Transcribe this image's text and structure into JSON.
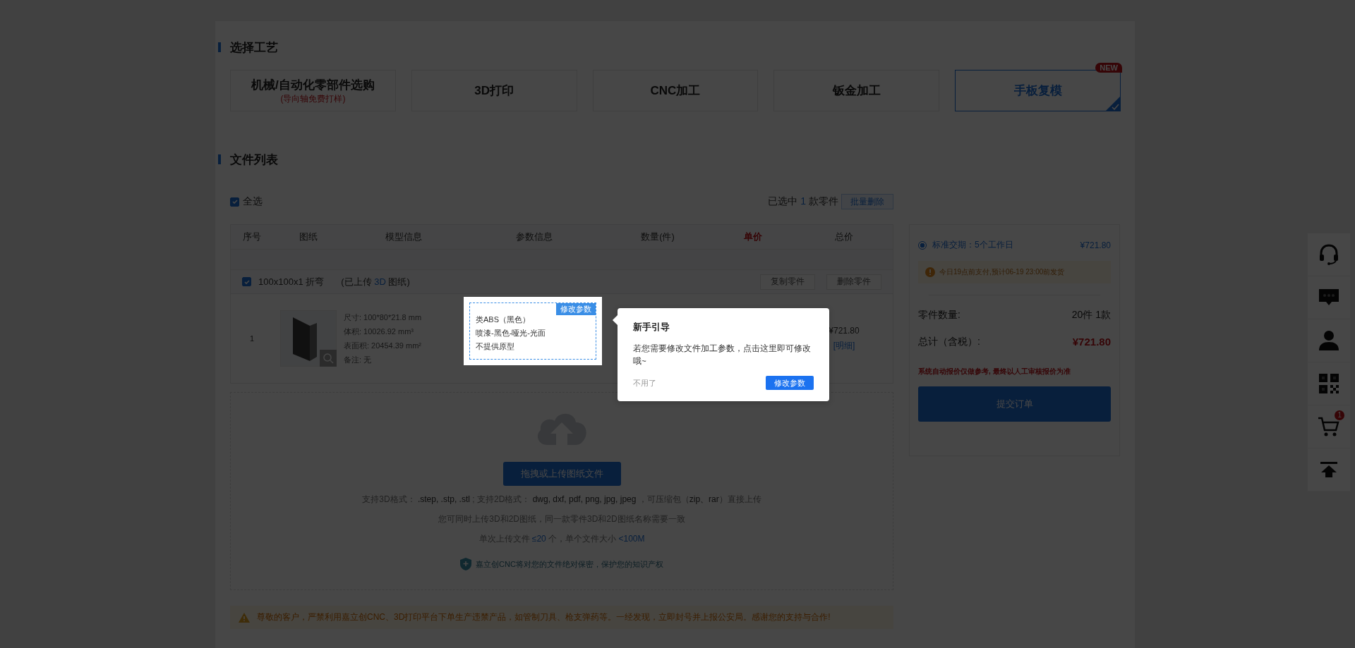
{
  "process_section": {
    "title": "选择工艺",
    "processes": [
      {
        "label": "机械/自动化零部件选购",
        "sublabel": "(导向轴免费打样)",
        "selected": false
      },
      {
        "label": "3D打印",
        "selected": false
      },
      {
        "label": "CNC加工",
        "selected": false
      },
      {
        "label": "钣金加工",
        "selected": false
      },
      {
        "label": "手板复模",
        "selected": true,
        "badge": "NEW"
      }
    ]
  },
  "file_section": {
    "title": "文件列表",
    "select_all": {
      "label": "全选",
      "checked": true
    },
    "selection_summary": {
      "prefix": "已选中",
      "count": "1",
      "suffix": "款零件"
    },
    "batch_delete": "批量删除",
    "table": {
      "columns": [
        "序号",
        "图纸",
        "模型信息",
        "参数信息",
        "数量(件)",
        "单价",
        "总价"
      ],
      "groups": [
        {
          "name": "100x100x1 折弯",
          "checked": true,
          "uploaded_prefix": "(已上传",
          "uploaded_type": "3D",
          "uploaded_suffix": "图纸)",
          "actions": [
            "复制零件",
            "删除零件"
          ],
          "rows": [
            {
              "index": "1",
              "model_info": [
                "尺寸: 100*80*21.8 mm",
                "体积: 10026.92 mm³",
                "表面积: 20454.39 mm²",
                "备注: 无"
              ],
              "params": {
                "tag": "修改参数",
                "lines": [
                  "类ABS（黑色）",
                  "喷漆-黑色-哑光-光面",
                  "不提供原型"
                ]
              },
              "total": "¥721.80",
              "detail_link": "[明细]"
            }
          ]
        }
      ]
    },
    "upload": {
      "button": "拖拽或上传图纸文件",
      "lines": [
        [
          {
            "text": "支持3D格式：",
            "kind": "plain"
          },
          {
            "text": " .step, .stp, .stl",
            "kind": "value"
          },
          {
            "text": " ; 支持2D格式：",
            "kind": "plain"
          },
          {
            "text": " dwg, dxf, pdf, png, jpg, jpeg",
            "kind": "value"
          },
          {
            "text": " ，可压缩包（",
            "kind": "plain"
          },
          {
            "text": "zip、rar",
            "kind": "value"
          },
          {
            "text": "）直接上传",
            "kind": "plain"
          }
        ],
        [
          {
            "text": "您可同时上传3D和2D图纸，同一款零件3D和2D图纸名称需要一致",
            "kind": "plain"
          }
        ],
        [
          {
            "text": "单次上传文件 ",
            "kind": "plain"
          },
          {
            "text": "≤20",
            "kind": "link"
          },
          {
            "text": " 个，单个文件大小 ",
            "kind": "plain"
          },
          {
            "text": "<100M",
            "kind": "link"
          }
        ]
      ],
      "privacy": "嘉立创CNC将对您的文件绝对保密，保护您的知识产权"
    },
    "warning": "尊敬的客户，严禁利用嘉立创CNC、3D打印平台下单生产违禁产品，如管制刀具、枪支弹药等。一经发现，立即封号并上报公安局。感谢您的支持与合作!"
  },
  "order_summary": {
    "delivery": {
      "label": "标准交期：5个工作日",
      "price": "¥721.80",
      "selected": true
    },
    "notice": "今日19点前支付,预计06-19 23:00前发货",
    "quantity_label": "零件数量:",
    "quantity_value": "20件  1款",
    "total_label": "总计（含税）:",
    "total_value": "¥721.80",
    "disclaimer": "系统自动报价仅做参考, 最终以人工审核报价为准",
    "submit": "提交订单"
  },
  "toolbar": [
    {
      "kind": "headset"
    },
    {
      "kind": "chat"
    },
    {
      "kind": "user"
    },
    {
      "kind": "qrcode"
    },
    {
      "kind": "cart",
      "badge": "1"
    },
    {
      "kind": "top"
    }
  ],
  "guide": {
    "title": "新手引导",
    "text": "若您需要修改文件加工参数，点击这里即可修改哦~",
    "dismiss": "不用了",
    "confirm": "修改参数"
  }
}
